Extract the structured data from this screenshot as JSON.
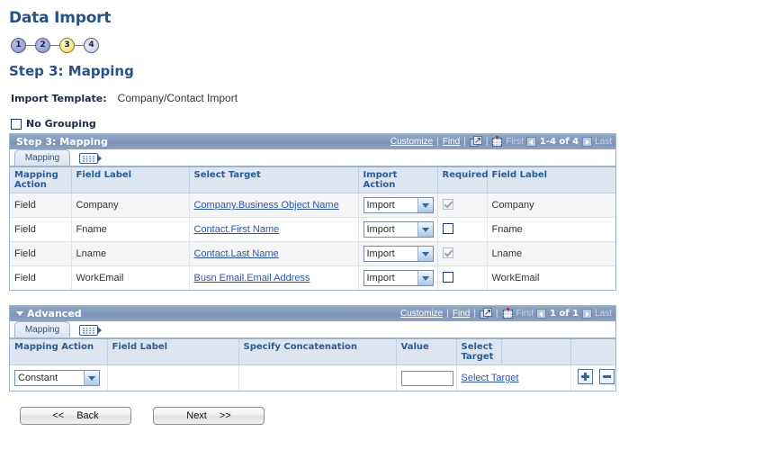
{
  "page": {
    "title": "Data Import",
    "step_title": "Step 3: Mapping"
  },
  "steps": [
    {
      "number": "1",
      "state": "done"
    },
    {
      "number": "2",
      "state": "done"
    },
    {
      "number": "3",
      "state": "current"
    },
    {
      "number": "4",
      "state": "todo"
    }
  ],
  "template": {
    "label": "Import Template:",
    "value": "Company/Contact Import"
  },
  "no_grouping": {
    "label": "No Grouping",
    "checked": false
  },
  "mapping_grid": {
    "title": "Step 3: Mapping",
    "toolbar": {
      "customize": "Customize",
      "find": "Find",
      "separator": "|",
      "expand_icon": "expand-icon",
      "download_icon": "download-spreadsheet-icon",
      "first": "First",
      "prev_icon": "prev-arrow-icon",
      "range": "1-4 of 4",
      "next_icon": "next-arrow-icon",
      "last": "Last"
    },
    "tab": "Mapping",
    "tab_icon": "show-all-columns-icon",
    "columns": [
      "Mapping Action",
      "Field Label",
      "Select Target",
      "Import Action",
      "Required",
      "Field Label"
    ],
    "rows": [
      {
        "mapping_action": "Field",
        "field_label": "Company",
        "select_target": "Company.Business Object Name",
        "import_action": "Import",
        "required_checked": true,
        "required_disabled": true,
        "field_label_2": "Company"
      },
      {
        "mapping_action": "Field",
        "field_label": "Fname",
        "select_target": "Contact.First Name",
        "import_action": "Import",
        "required_checked": false,
        "required_disabled": false,
        "field_label_2": "Fname"
      },
      {
        "mapping_action": "Field",
        "field_label": "Lname",
        "select_target": "Contact.Last Name",
        "import_action": "Import",
        "required_checked": true,
        "required_disabled": true,
        "field_label_2": "Lname"
      },
      {
        "mapping_action": "Field",
        "field_label": "WorkEmail",
        "select_target": "Busn Email.Email Address",
        "import_action": "Import",
        "required_checked": false,
        "required_disabled": false,
        "field_label_2": "WorkEmail"
      }
    ]
  },
  "advanced_grid": {
    "title": "Advanced",
    "collapse_icon": "collapse-triangle-icon",
    "toolbar": {
      "customize": "Customize",
      "find": "Find",
      "separator": "|",
      "expand_icon": "expand-icon",
      "download_icon": "download-spreadsheet-icon",
      "first": "First",
      "prev_icon": "prev-arrow-icon",
      "range": "1 of 1",
      "next_icon": "next-arrow-icon",
      "last": "Last"
    },
    "tab": "Mapping",
    "tab_icon": "show-all-columns-icon",
    "columns": [
      "Mapping Action",
      "Field Label",
      "Specify Concatenation",
      "Value",
      "Select Target",
      "",
      ""
    ],
    "rows": [
      {
        "mapping_action": "Constant",
        "field_label": "",
        "specify_concatenation": "",
        "value": "",
        "value_placeholder": "",
        "select_target_link": "Select Target",
        "add_button": "add-row-button",
        "remove_button": "remove-row-button"
      }
    ]
  },
  "footer": {
    "back_prefix": "<<",
    "back_label": "Back",
    "next_label": "Next",
    "next_suffix": ">>"
  },
  "colors": {
    "title_blue": "#28518c",
    "header_bar": "#8099bb",
    "column_header_bg": "#dde5f0",
    "column_header_text": "#2c5c91",
    "link_blue": "#2b56a7",
    "current_step": "#f8e395",
    "done_step": "#9aa6dd"
  }
}
